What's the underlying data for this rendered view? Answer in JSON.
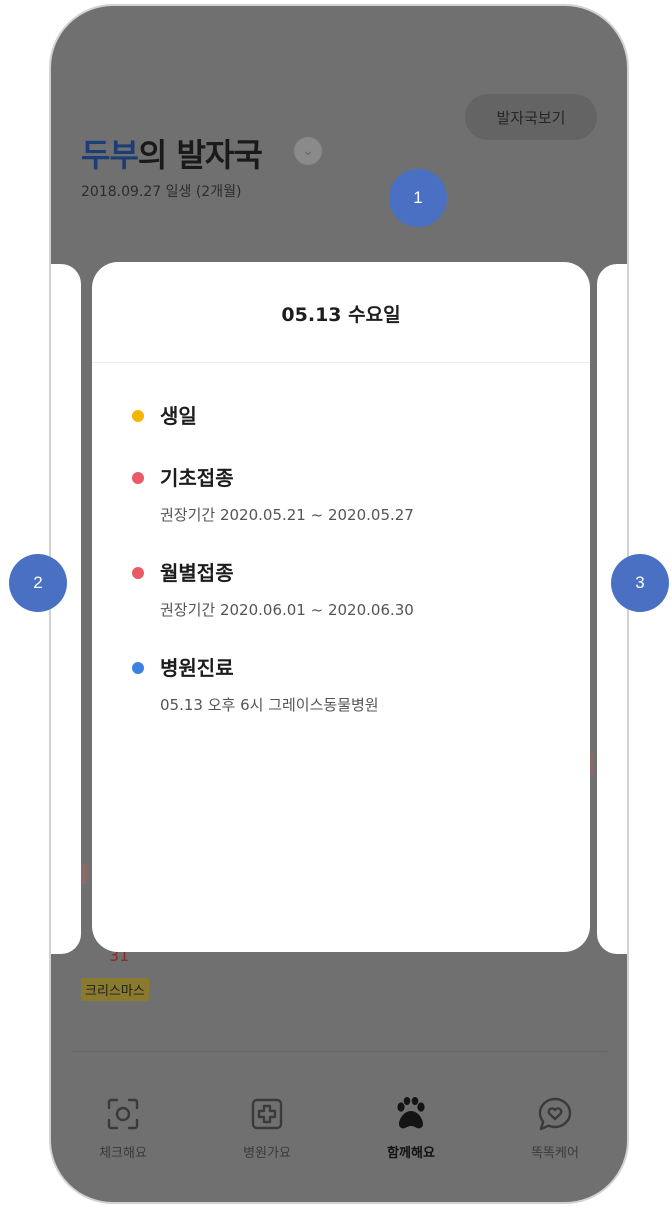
{
  "header": {
    "pet_name": "두부",
    "title_suffix": "의 발자국",
    "birth_info": "2018.09.27 일생 (2개월)",
    "view_button": "발자국보기"
  },
  "background": {
    "day_label": "31",
    "holiday_badge": "크리스마스"
  },
  "card": {
    "date": "05.13 수요일",
    "events": [
      {
        "title": "생일",
        "detail": "",
        "color": "#f4b400"
      },
      {
        "title": "기초접종",
        "detail": "권장기간 2020.05.21 ~ 2020.05.27",
        "color": "#e85a66"
      },
      {
        "title": "월별접종",
        "detail": "권장기간 2020.06.01 ~ 2020.06.30",
        "color": "#e85a66"
      },
      {
        "title": "병원진료",
        "detail": "05.13 오후 6시 그레이스동물병원",
        "color": "#3b82e0"
      }
    ]
  },
  "tabs": [
    {
      "label": "체크해요",
      "icon": "scan-icon"
    },
    {
      "label": "병원가요",
      "icon": "hospital-cross-icon"
    },
    {
      "label": "함께해요",
      "icon": "paw-icon",
      "active": true
    },
    {
      "label": "똑똑케어",
      "icon": "heart-chat-icon"
    }
  ],
  "markers": [
    "1",
    "2",
    "3"
  ],
  "colors": {
    "marker": "#4a70c4",
    "name_accent": "#1d3e74"
  }
}
